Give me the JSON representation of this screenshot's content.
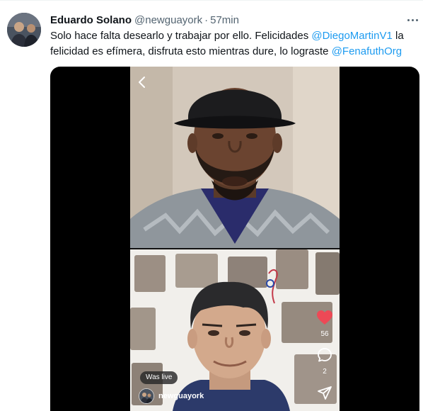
{
  "tweet": {
    "author_name": "Eduardo Solano",
    "author_handle": "@newguayork",
    "separator": "·",
    "time": "57min",
    "text_part1": "Solo hace falta desearlo y trabajar por ello. Felicidades ",
    "mention1": "@DiegoMartinV1",
    "text_part2": " la felicidad es efímera, disfruta esto mientras dure, lo lograste ",
    "mention2": "@FenafuthOrg",
    "accent_color": "#1d9bf0"
  },
  "video": {
    "live_badge": "Was live",
    "username": "newguayork",
    "like_count": "56",
    "comment_count": "2",
    "icons": [
      "back-arrow-icon",
      "heart-icon",
      "comment-icon",
      "send-icon"
    ]
  }
}
